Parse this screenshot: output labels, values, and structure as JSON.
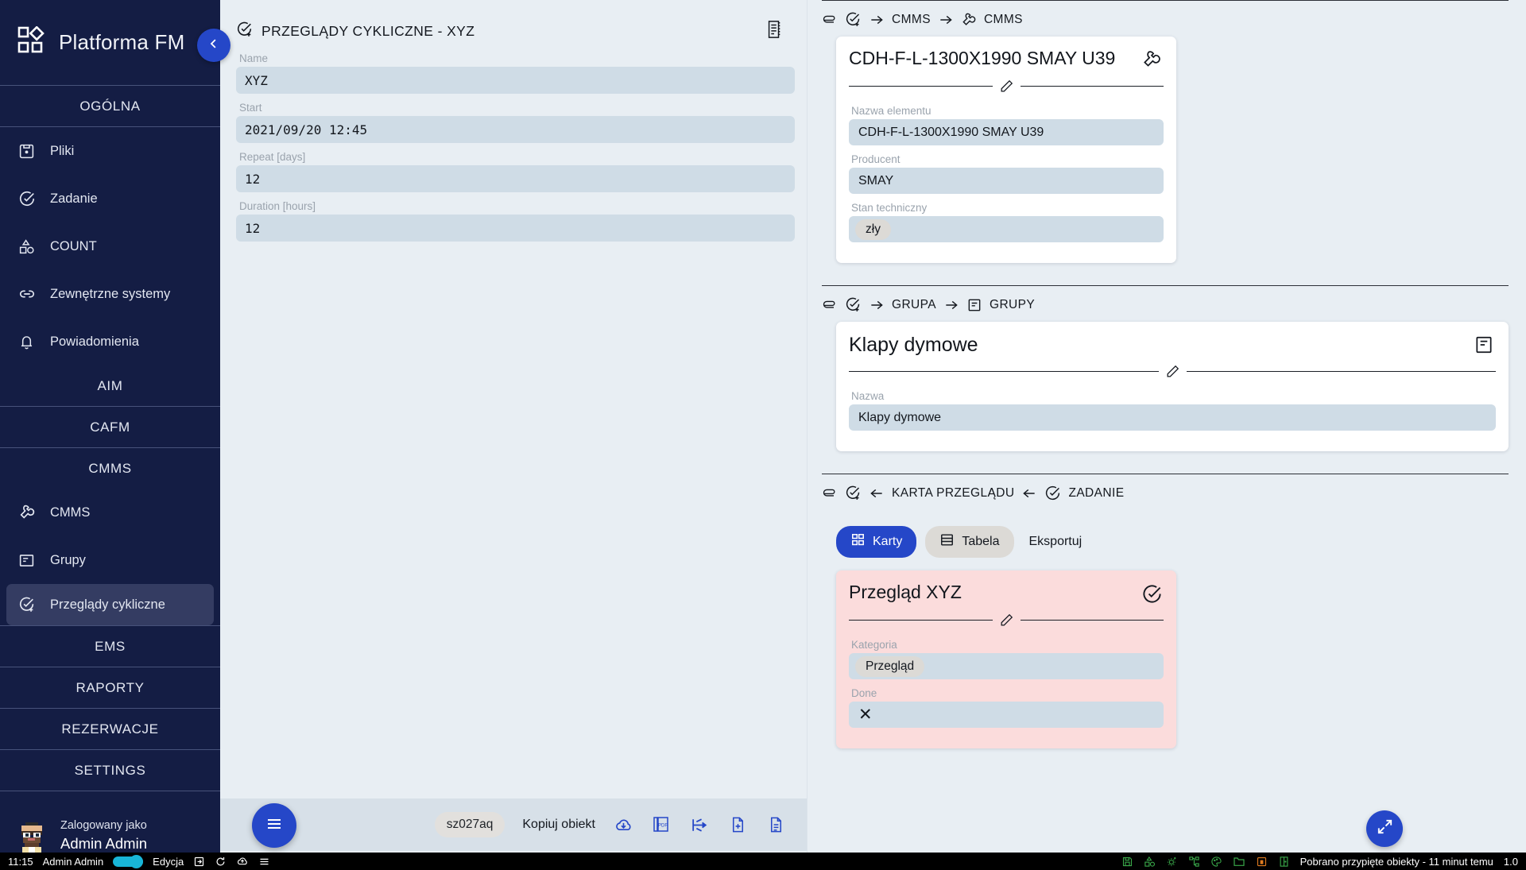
{
  "brand": {
    "name": "Platforma FM",
    "logo_icon": "app-logo-icon"
  },
  "sidebar": {
    "sections": [
      {
        "label": "OGÓLNA",
        "items": [
          {
            "label": "Pliki",
            "icon": "file-save-icon"
          },
          {
            "label": "Zadanie",
            "icon": "check-circle-icon"
          },
          {
            "label": "COUNT",
            "icon": "shapes-count-icon"
          },
          {
            "label": "Zewnętrzne systemy",
            "icon": "link-icon"
          },
          {
            "label": "Powiadomienia",
            "icon": "bell-icon"
          }
        ]
      },
      {
        "label": "AIM",
        "items": []
      },
      {
        "label": "CAFM",
        "items": []
      },
      {
        "label": "CMMS",
        "items": [
          {
            "label": "CMMS",
            "icon": "wrench-icon"
          },
          {
            "label": "Grupy",
            "icon": "list-card-icon"
          },
          {
            "label": "Przeglądy cykliczne",
            "icon": "check-plus-icon",
            "active": true
          }
        ]
      },
      {
        "label": "EMS",
        "items": []
      },
      {
        "label": "RAPORTY",
        "items": []
      },
      {
        "label": "REZERWACJE",
        "items": []
      },
      {
        "label": "SETTINGS",
        "items": []
      }
    ],
    "user": {
      "logged_in_as": "Zalogowany jako",
      "name": "Admin Admin",
      "avatar": "user-avatar"
    },
    "collapse_icon": "chevron-left-icon"
  },
  "left_panel": {
    "header_icon": "check-plus-icon",
    "title": "PRZEGLĄDY CYKLICZNE - XYZ",
    "header_action_icon": "document-list-icon",
    "fields": [
      {
        "label": "Name",
        "value": "XYZ"
      },
      {
        "label": "Start",
        "value": "2021/09/20 12:45"
      },
      {
        "label": "Repeat [days]",
        "value": "12"
      },
      {
        "label": "Duration [hours]",
        "value": "12"
      }
    ],
    "footer": {
      "chip": "sz027aq",
      "copy_label": "Kopiuj obiekt",
      "icons": [
        "cloud-download-icon",
        "pdf-copy-icon",
        "split-arrow-icon",
        "file-add-icon",
        "file-text-icon"
      ],
      "menu_fab_icon": "hamburger-menu-icon"
    }
  },
  "right_panel": {
    "sections": [
      {
        "id": "cmms",
        "breadcrumb": {
          "lead_icons": [
            "paperclip-icon",
            "check-plus-icon"
          ],
          "items": [
            {
              "arrow": "arrow-right-icon",
              "icon": null,
              "label": "CMMS"
            },
            {
              "arrow": "arrow-right-icon",
              "icon": "wrench-icon",
              "label": "CMMS"
            }
          ]
        },
        "card": {
          "title": "CDH-F-L-1300X1990 SMAY U39",
          "corner_icon": "wrench-icon",
          "edit_icon": "pencil-icon",
          "width": "narrow",
          "fields": [
            {
              "label": "Nazwa elementu",
              "value": "CDH-F-L-1300X1990 SMAY U39",
              "chip": false
            },
            {
              "label": "Producent",
              "value": "SMAY",
              "chip": false
            },
            {
              "label": "Stan techniczny",
              "value": "zły",
              "chip": true
            }
          ]
        }
      },
      {
        "id": "grupa",
        "breadcrumb": {
          "lead_icons": [
            "paperclip-icon",
            "check-plus-icon"
          ],
          "items": [
            {
              "arrow": "arrow-right-icon",
              "icon": null,
              "label": "GRUPA"
            },
            {
              "arrow": "arrow-right-icon",
              "icon": "list-card-icon",
              "label": "GRUPY"
            }
          ]
        },
        "card": {
          "title": "Klapy dymowe",
          "corner_icon": "list-card-icon",
          "edit_icon": "pencil-icon",
          "width": "wide",
          "fields": [
            {
              "label": "Nazwa",
              "value": "Klapy dymowe",
              "chip": false
            }
          ]
        }
      },
      {
        "id": "karta-przegladu",
        "breadcrumb": {
          "lead_icons": [
            "paperclip-icon",
            "check-plus-icon"
          ],
          "items": [
            {
              "arrow": "arrow-left-icon",
              "icon": null,
              "label": "KARTA PRZEGLĄDU"
            },
            {
              "arrow": "arrow-left-icon",
              "icon": "check-circle-icon",
              "label": "ZADANIE"
            }
          ]
        },
        "tabs": [
          {
            "label": "Karty",
            "icon": "cards-grid-icon",
            "style": "primary"
          },
          {
            "label": "Tabela",
            "icon": "table-icon",
            "style": "secondary"
          },
          {
            "label": "Eksportuj",
            "icon": null,
            "style": "plain"
          }
        ],
        "card": {
          "title": "Przegląd XYZ",
          "corner_icon": "check-circle-icon",
          "edit_icon": "pencil-icon",
          "width": "narrow",
          "theme": "pink",
          "fields": [
            {
              "label": "Kategoria",
              "value": "Przegląd",
              "chip": true
            },
            {
              "label": "Done",
              "value": "✕",
              "chip": false
            }
          ]
        }
      }
    ],
    "fabs": [
      {
        "name": "expand",
        "icon": "expand-arrows-icon"
      },
      {
        "name": "history",
        "icon": "history-clock-icon"
      }
    ]
  },
  "statusbar": {
    "time": "11:15",
    "user": "Admin Admin",
    "mode": "Edycja",
    "left_icons": [
      "login-arrow-icon",
      "refresh-icon",
      "cloud-upload-icon",
      "menu-lines-icon"
    ],
    "right_icons": [
      "save-disk-icon",
      "shapes-icon",
      "gear-plus-icon",
      "tree-nodes-icon",
      "palette-icon",
      "folder-icon",
      "box-orange-icon",
      "door-icon"
    ],
    "message": "Pobrano przypięte obiekty - 11 minut temu",
    "version": "1.0"
  },
  "colors": {
    "sidebar_bg": "#141d44",
    "sidebar_active": "#343c62",
    "accent_blue": "#2547c8",
    "panel_bg": "#e8eef3",
    "input_bg": "#cfdce6",
    "pink_card": "#fbdcdc",
    "status_green": "#3aa84a",
    "status_orange": "#e07b20"
  }
}
